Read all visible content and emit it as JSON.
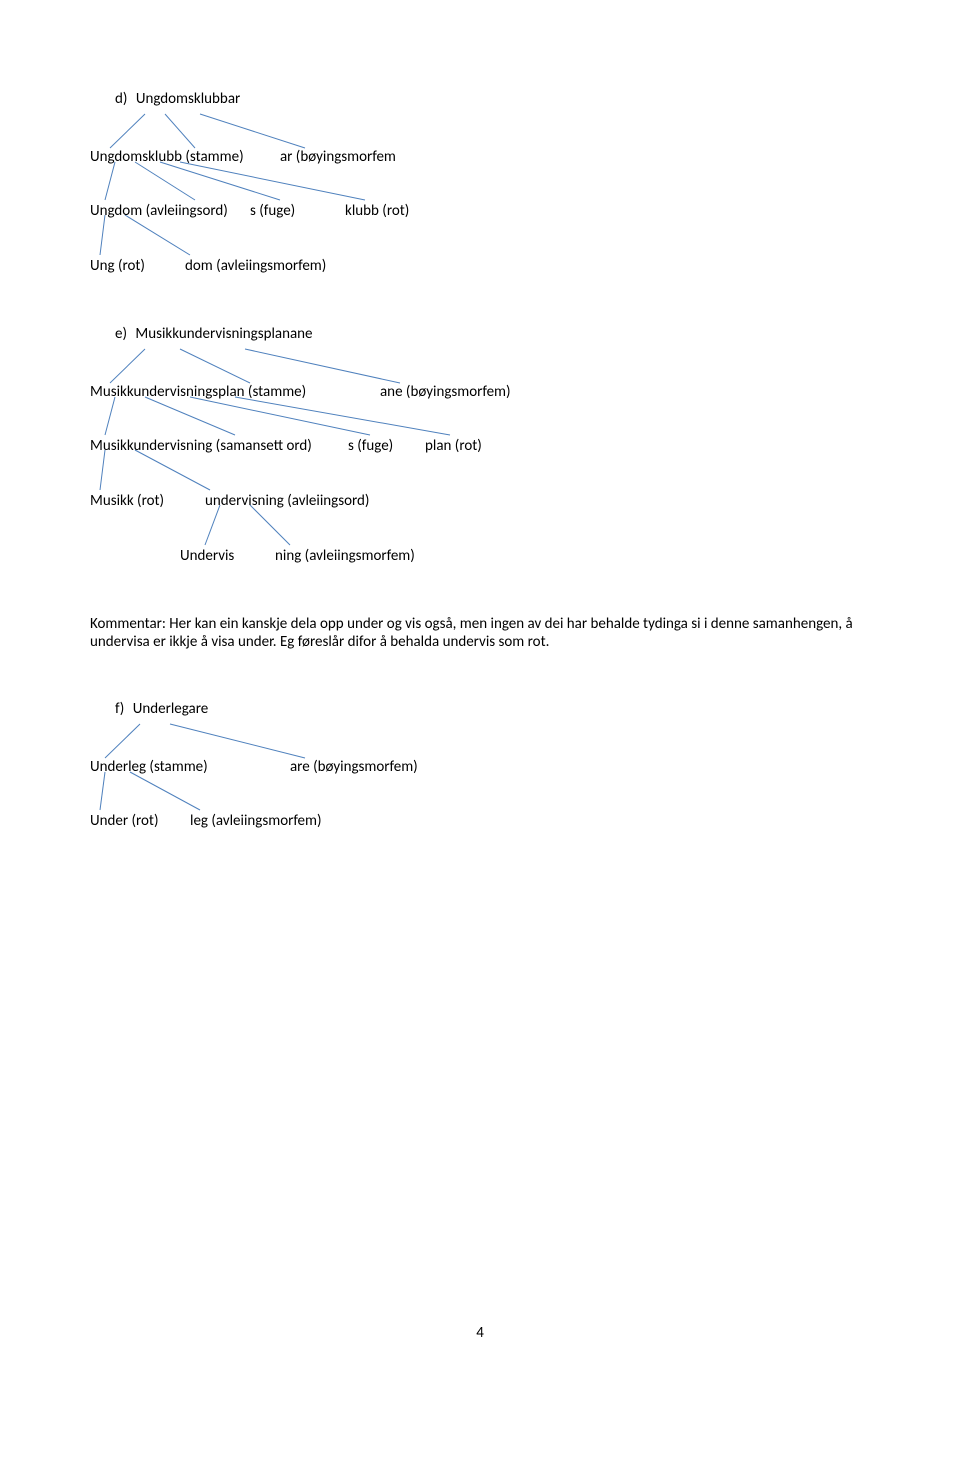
{
  "section_d": {
    "letter": "d)",
    "title": "Ungdomsklubbar",
    "level1_left": "Ungdomsklubb (stamme)",
    "level1_right": "ar (bøyingsmorfem",
    "level2_left": "Ungdom (avleiingsord)",
    "level2_mid": "s (fuge)",
    "level2_right": "klubb (rot)",
    "level3_left": "Ung (rot)",
    "level3_right": "dom (avleiingsmorfem)"
  },
  "section_e": {
    "letter": "e)",
    "title": "Musikkundervisningsplanane",
    "level1_left": "Musikkundervisningsplan (stamme)",
    "level1_right": "ane (bøyingsmorfem)",
    "level2_left": "Musikkundervisning (samansett ord)",
    "level2_mid": "s (fuge)",
    "level2_right": "plan (rot)",
    "level3_left": "Musikk (rot)",
    "level3_right": "undervisning (avleiingsord)",
    "level4_left": "Undervis",
    "level4_right": "ning (avleiingsmorfem)"
  },
  "comment": "Kommentar: Her kan ein kanskje dela opp under og vis også, men ingen av dei har behalde tydinga si i denne samanhengen, å undervisa er ikkje å visa under. Eg føreslår difor å behalda undervis som rot.",
  "section_f": {
    "letter": "f)",
    "title": "Underlegare",
    "level1_left": "Underleg (stamme)",
    "level1_right": "are (bøyingsmorfem)",
    "level2_left": "Under (rot)",
    "level2_right": "leg (avleiingsmorfem)"
  },
  "page_number": "4",
  "line_color": "#4f81bd"
}
